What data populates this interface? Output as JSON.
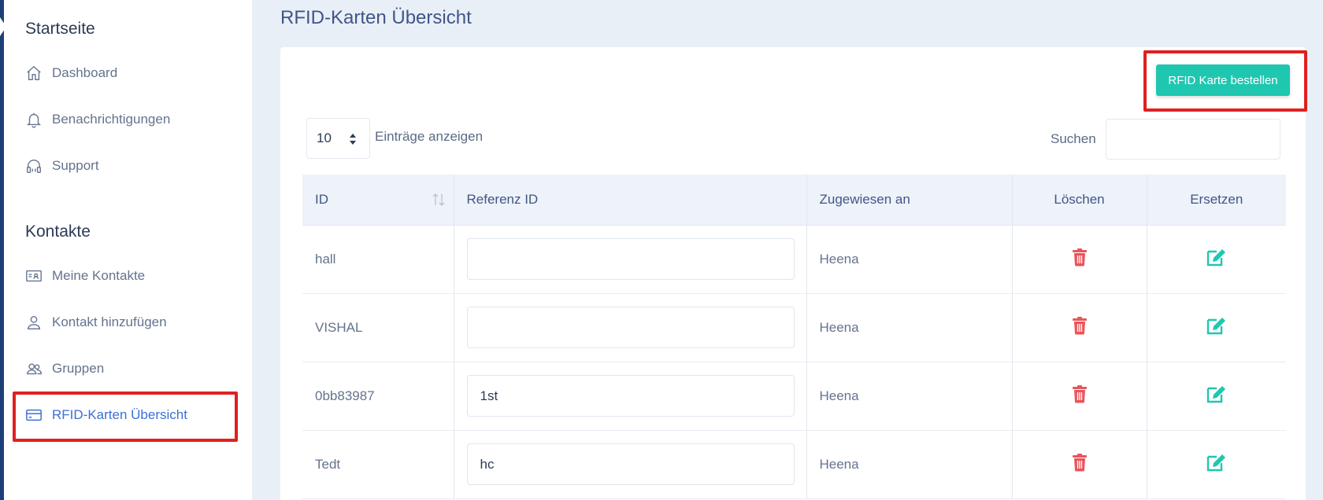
{
  "sidebar": {
    "section_start": "Startseite",
    "section_contacts": "Kontakte",
    "items": [
      {
        "label": "Dashboard",
        "icon": "home-icon"
      },
      {
        "label": "Benachrichtigungen",
        "icon": "bell-icon"
      },
      {
        "label": "Support",
        "icon": "headphones-icon"
      },
      {
        "label": "Meine Kontakte",
        "icon": "contact-card-icon"
      },
      {
        "label": "Kontakt hinzufügen",
        "icon": "user-icon"
      },
      {
        "label": "Gruppen",
        "icon": "users-icon"
      },
      {
        "label": "RFID-Karten Übersicht",
        "icon": "credit-card-icon",
        "active": true
      }
    ]
  },
  "main": {
    "title": "RFID-Karten Übersicht",
    "order_button": "RFID Karte bestellen",
    "length_value": "10",
    "length_label": "Einträge anzeigen",
    "search_label": "Suchen",
    "search_value": ""
  },
  "table": {
    "headers": {
      "id": "ID",
      "ref": "Referenz ID",
      "assigned": "Zugewiesen an",
      "delete": "Löschen",
      "replace": "Ersetzen"
    },
    "rows": [
      {
        "id": "hall",
        "ref": "",
        "assigned": "Heena"
      },
      {
        "id": "VISHAL",
        "ref": "",
        "assigned": "Heena"
      },
      {
        "id": "0bb83987",
        "ref": "1st",
        "assigned": "Heena"
      },
      {
        "id": "Tedt",
        "ref": "hc",
        "assigned": "Heena"
      }
    ]
  },
  "colors": {
    "accent_teal": "#1fc7b0",
    "delete_red": "#e8555b",
    "highlight_red": "#e0201f",
    "active_blue": "#3b6fd6",
    "sidebar_edge": "#1d3f79"
  }
}
